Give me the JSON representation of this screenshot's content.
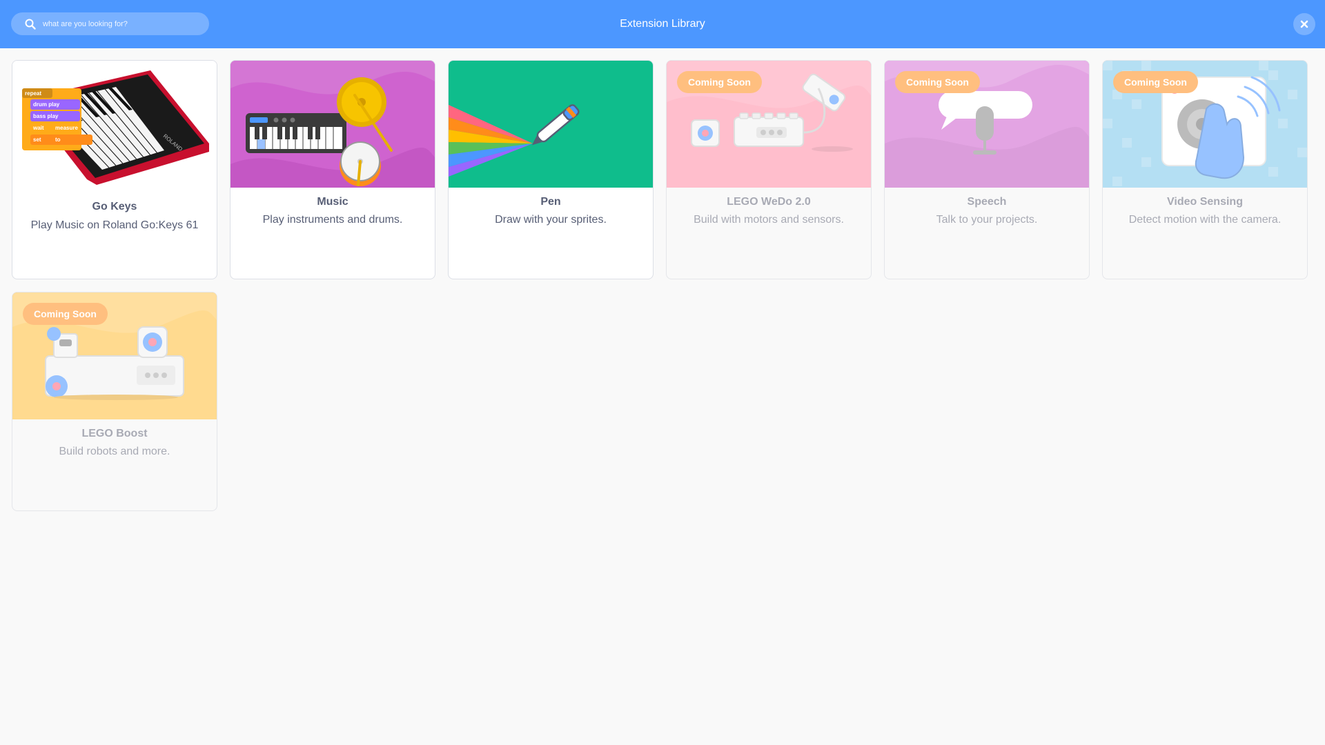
{
  "header": {
    "title": "Extension Library",
    "search_placeholder": "what are you looking for?",
    "search_value": ""
  },
  "colors": {
    "header": "#4c97ff",
    "badge": "#ffbf7f",
    "text": "#575e75",
    "text_disabled": "#a8aab4"
  },
  "extensions": [
    {
      "name": "Go Keys",
      "description": "Play Music on Roland Go:Keys 61",
      "badge": ""
    },
    {
      "name": "Music",
      "description": "Play instruments and drums.",
      "badge": ""
    },
    {
      "name": "Pen",
      "description": "Draw with your sprites.",
      "badge": ""
    },
    {
      "name": "LEGO WeDo 2.0",
      "description": "Build with motors and sensors.",
      "badge": "Coming Soon"
    },
    {
      "name": "Speech",
      "description": "Talk to your projects.",
      "badge": "Coming Soon"
    },
    {
      "name": "Video Sensing",
      "description": "Detect motion with the camera.",
      "badge": "Coming Soon"
    },
    {
      "name": "LEGO Boost",
      "description": "Build robots and more.",
      "badge": "Coming Soon"
    }
  ],
  "gokeys_blocks": {
    "repeat": "repeat",
    "drum_play": "drum play",
    "bass_play": "bass play",
    "wait": "wait",
    "measure": "measure",
    "set": "set",
    "to": "to",
    "brand": "ROLAND"
  }
}
